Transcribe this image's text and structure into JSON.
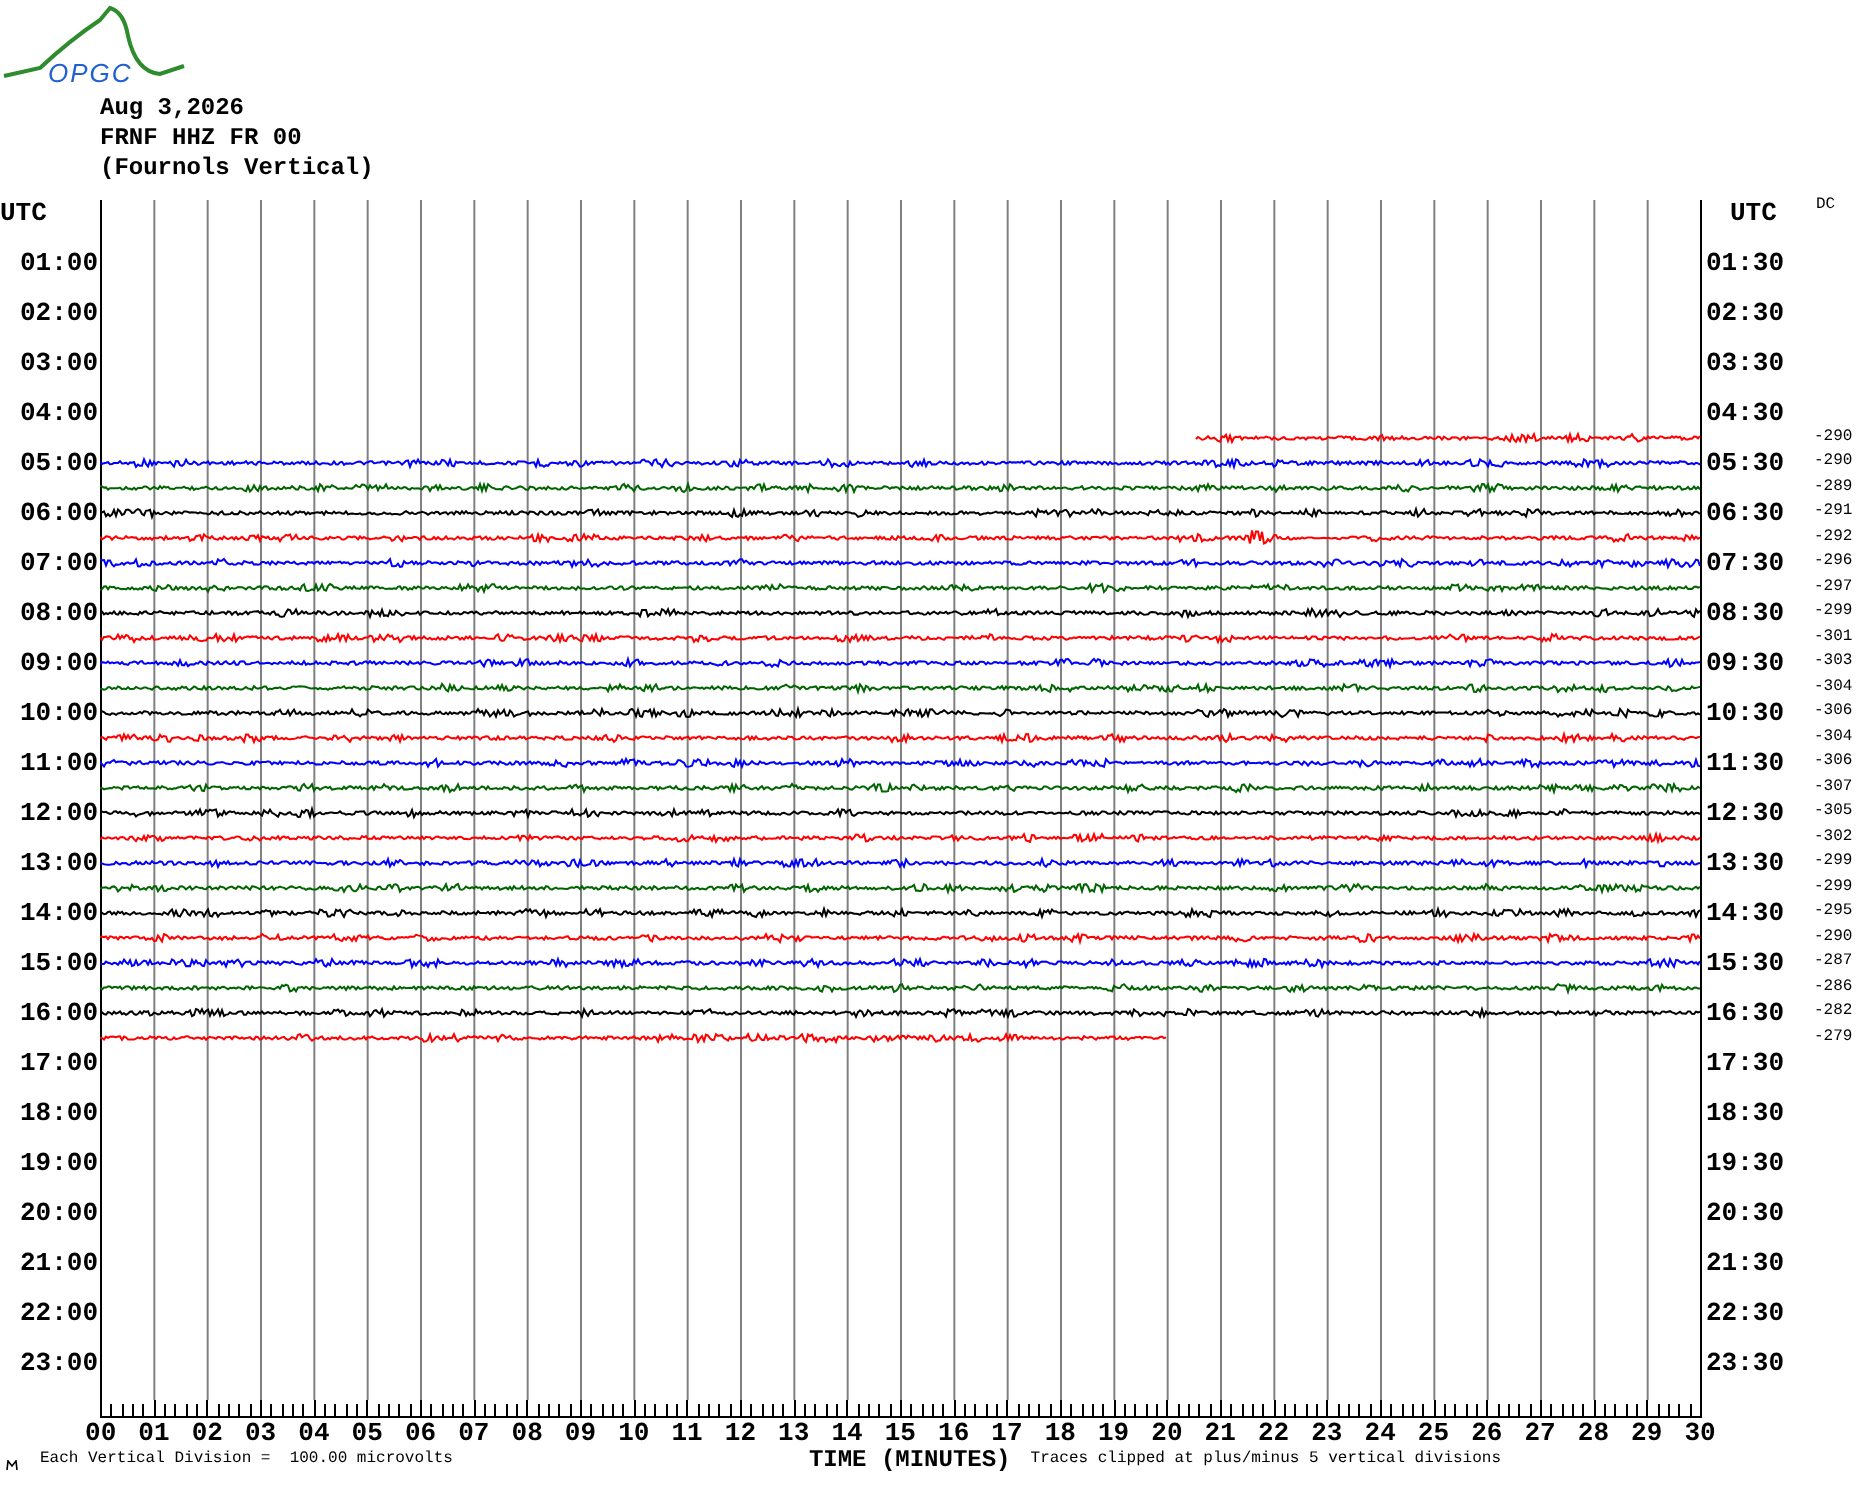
{
  "logo": {
    "text": "OPGC"
  },
  "header": {
    "date": "Aug 3,2026",
    "station": "FRNF HHZ FR 00",
    "site": "(Fournols Vertical)"
  },
  "left_axis": {
    "title": "UTC",
    "labels": [
      "01:00",
      "02:00",
      "03:00",
      "04:00",
      "05:00",
      "06:00",
      "07:00",
      "08:00",
      "09:00",
      "10:00",
      "11:00",
      "12:00",
      "13:00",
      "14:00",
      "15:00",
      "16:00",
      "17:00",
      "18:00",
      "19:00",
      "20:00",
      "21:00",
      "22:00",
      "23:00"
    ]
  },
  "right_axis": {
    "title": "UTC",
    "labels": [
      "01:30",
      "02:30",
      "03:30",
      "04:30",
      "05:30",
      "06:30",
      "07:30",
      "08:30",
      "09:30",
      "10:30",
      "11:30",
      "12:30",
      "13:30",
      "14:30",
      "15:30",
      "16:30",
      "17:30",
      "18:30",
      "19:30",
      "20:30",
      "21:30",
      "22:30",
      "23:30"
    ]
  },
  "dc": {
    "title": "DC"
  },
  "traces": [
    {
      "color": "#ff0000",
      "kind": "late-start",
      "level": 0.315,
      "event": false,
      "dc": "-290"
    },
    {
      "color": "#0000ff",
      "kind": "full",
      "level": 1,
      "event": false,
      "dc": "-290"
    },
    {
      "color": "#006400",
      "kind": "full",
      "level": 1,
      "event": false,
      "dc": "-289"
    },
    {
      "color": "#000000",
      "kind": "full",
      "level": 1,
      "event": false,
      "dc": "-291"
    },
    {
      "color": "#ff0000",
      "kind": "full",
      "level": 1,
      "event": true,
      "dc": "-292"
    },
    {
      "color": "#0000ff",
      "kind": "full",
      "level": 1,
      "event": false,
      "dc": "-296"
    },
    {
      "color": "#006400",
      "kind": "full",
      "level": 1,
      "event": false,
      "dc": "-297"
    },
    {
      "color": "#000000",
      "kind": "full",
      "level": 1,
      "event": false,
      "dc": "-299"
    },
    {
      "color": "#ff0000",
      "kind": "full",
      "level": 1,
      "event": false,
      "dc": "-301"
    },
    {
      "color": "#0000ff",
      "kind": "full",
      "level": 1,
      "event": false,
      "dc": "-303"
    },
    {
      "color": "#006400",
      "kind": "full",
      "level": 1,
      "event": false,
      "dc": "-304"
    },
    {
      "color": "#000000",
      "kind": "full",
      "level": 1,
      "event": false,
      "dc": "-306"
    },
    {
      "color": "#ff0000",
      "kind": "full",
      "level": 1,
      "event": false,
      "dc": "-304"
    },
    {
      "color": "#0000ff",
      "kind": "full",
      "level": 1,
      "event": false,
      "dc": "-306"
    },
    {
      "color": "#006400",
      "kind": "full",
      "level": 1,
      "event": false,
      "dc": "-307"
    },
    {
      "color": "#000000",
      "kind": "full",
      "level": 1,
      "event": false,
      "dc": "-305"
    },
    {
      "color": "#ff0000",
      "kind": "full",
      "level": 1,
      "event": false,
      "dc": "-302"
    },
    {
      "color": "#0000ff",
      "kind": "full",
      "level": 1,
      "event": false,
      "dc": "-299"
    },
    {
      "color": "#006400",
      "kind": "full",
      "level": 1,
      "event": false,
      "dc": "-299"
    },
    {
      "color": "#000000",
      "kind": "full",
      "level": 1,
      "event": false,
      "dc": "-295"
    },
    {
      "color": "#ff0000",
      "kind": "full",
      "level": 1,
      "event": false,
      "dc": "-290"
    },
    {
      "color": "#0000ff",
      "kind": "full",
      "level": 1,
      "event": false,
      "dc": "-287"
    },
    {
      "color": "#006400",
      "kind": "full",
      "level": 1,
      "event": false,
      "dc": "-286"
    },
    {
      "color": "#000000",
      "kind": "full",
      "level": 1,
      "event": false,
      "dc": "-282"
    },
    {
      "color": "#ff0000",
      "kind": "early-end",
      "level": 0.666,
      "event": false,
      "dc": "-279"
    }
  ],
  "x_axis": {
    "labels": [
      "00",
      "01",
      "02",
      "03",
      "04",
      "05",
      "06",
      "07",
      "08",
      "09",
      "10",
      "11",
      "12",
      "13",
      "14",
      "15",
      "16",
      "17",
      "18",
      "19",
      "20",
      "21",
      "22",
      "23",
      "24",
      "25",
      "26",
      "27",
      "28",
      "29",
      "30"
    ],
    "title": "TIME (MINUTES)"
  },
  "footer": {
    "scale_note": "Each Vertical Division =  100.00 microvolts",
    "clip_note": "Traces clipped at plus/minus 5 vertical divisions"
  }
}
